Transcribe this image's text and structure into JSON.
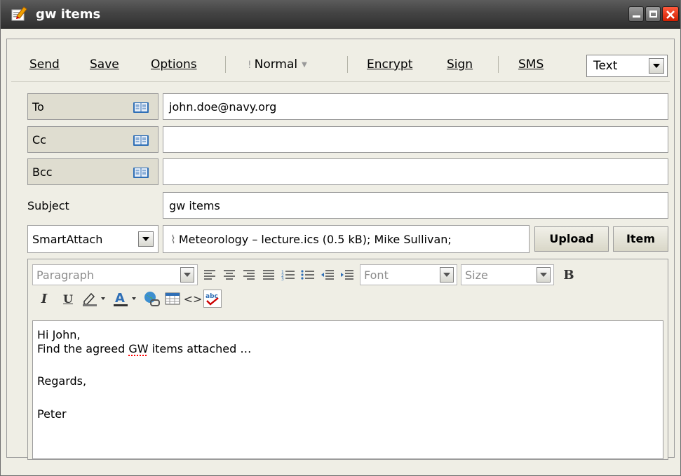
{
  "window": {
    "title": "gw items",
    "icon": "compose-icon"
  },
  "toolbar": {
    "send": "Send",
    "save": "Save",
    "options": "Options",
    "priority": "Normal",
    "encrypt": "Encrypt",
    "sign": "Sign",
    "sms": "SMS",
    "format": "Text"
  },
  "address": {
    "to_label": "To",
    "to_value": "john.doe@navy.org",
    "cc_label": "Cc",
    "cc_value": "",
    "bcc_label": "Bcc",
    "bcc_value": "",
    "subject_label": "Subject",
    "subject_value": "gw items"
  },
  "attach": {
    "mode": "SmartAttach",
    "attachments": "Meteorology – lecture.ics (0.5 kB); Mike Sullivan;",
    "upload": "Upload",
    "item": "Item"
  },
  "editor": {
    "paragraph": "Paragraph",
    "font": "Font",
    "size": "Size",
    "bold": "B",
    "italic": "I",
    "underline": "U"
  },
  "message": {
    "greeting": "Hi John,",
    "line1_before": "Find the agreed ",
    "line1_misspelled": "GW",
    "line1_after": " items attached …",
    "closing": "Regards,",
    "signature": "Peter"
  },
  "colors": {
    "titlebar": "#444444",
    "panel": "#efeee5",
    "label_bg": "#dfddd0",
    "close": "#d11e00"
  }
}
